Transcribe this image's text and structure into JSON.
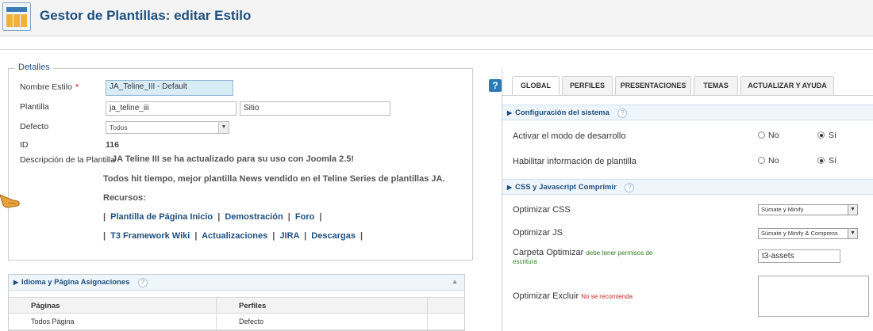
{
  "header": {
    "title": "Gestor de Plantillas: editar Estilo"
  },
  "details": {
    "legend": "Detalles",
    "style_name_label": "Nombre Estilo",
    "required_mark": "*",
    "style_name_value": "JA_Teline_III - Default",
    "template_label": "Plantilla",
    "template_value": "ja_teline_iii",
    "client_value": "Sitio",
    "default_label": "Defecto",
    "default_value": "Todos",
    "id_label": "ID",
    "id_value": "116",
    "desc_label": "Descripción de la Plantilla",
    "desc_line1": "JA Teline III se ha actualizado para su uso con Joomla 2.5!",
    "desc_line2": "Todos hit tiempo, mejor plantilla News vendido en el Teline Series de plantillas JA.",
    "resources_label": "Recursos:",
    "links_row1": [
      "Plantilla de Página Inicio",
      "Demostración",
      "Foro"
    ],
    "links_row2": [
      "T3 Framework Wiki",
      "Actualizaciones",
      "JIRA",
      "Descargas"
    ],
    "separator": "|"
  },
  "assignments": {
    "title": "Idioma y Página Asignaciones",
    "columns": [
      "Páginas",
      "Perfiles"
    ],
    "rows": [
      [
        "Todos Página",
        "Defecto"
      ]
    ]
  },
  "right_panel": {
    "help_icon": "?",
    "tabs": [
      "GLOBAL",
      "PERFILES",
      "PRESENTACIONES",
      "TEMAS",
      "ACTUALIZAR Y AYUDA"
    ],
    "active_tab": "GLOBAL",
    "section1_title": "Configuración del sistema",
    "dev_mode_label": "Activar el modo de desarrollo",
    "template_info_label": "Habilitar información de plantilla",
    "no_label": "No",
    "yes_label": "Sí",
    "section2_title": "CSS y Javascript Comprimir",
    "optimize_css_label": "Optimizar CSS",
    "optimize_css_value": "Súmate y Minify",
    "optimize_js_label": "Optimizar JS",
    "optimize_js_value": "Súmate y Minify & Compress",
    "folder_label": "Carpeta Optimizar",
    "folder_note": "debe tener permisos de escritura",
    "folder_value": "t3-assets",
    "exclude_label": "Optimizar Excluir",
    "exclude_note": "No se recomienda",
    "qmark": "?"
  },
  "colors": {
    "title_blue": "#1e4f7f",
    "section_bg": "#eef5fb",
    "highlight_input": "#d8ecf8"
  }
}
